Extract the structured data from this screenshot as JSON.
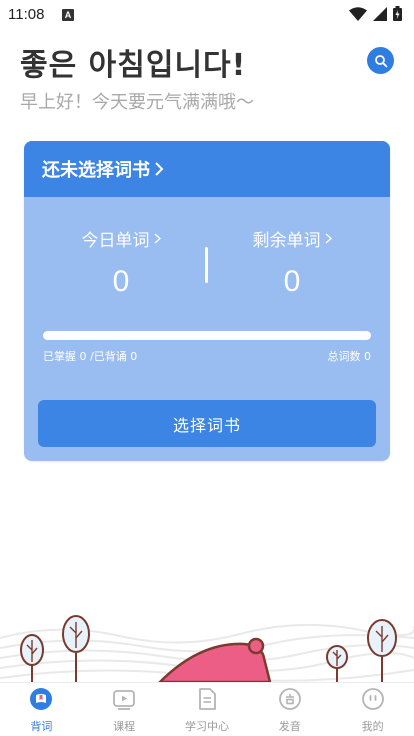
{
  "status": {
    "time": "11:08",
    "app_indicator": "A"
  },
  "header": {
    "greeting": "좋은 아침입니다!",
    "subgreeting": "早上好！今天要元气满满哦～"
  },
  "card": {
    "title": "还未选择词书",
    "today_words": {
      "label": "今日单词",
      "value": "0"
    },
    "remaining_words": {
      "label": "剩余单词",
      "value": "0"
    },
    "progress": {
      "fraction": 0,
      "left_text": "已掌握 0 /已背诵 0",
      "right_text": "总词数 0"
    },
    "button_label": "选择词书"
  },
  "tabs": [
    {
      "label": "背词",
      "icon": "book-bookmark-icon",
      "active": true
    },
    {
      "label": "课程",
      "icon": "play-video-icon",
      "active": false
    },
    {
      "label": "学习中心",
      "icon": "document-icon",
      "active": false
    },
    {
      "label": "发音",
      "icon": "pronunciation-icon",
      "active": false
    },
    {
      "label": "我的",
      "icon": "profile-face-icon",
      "active": false
    }
  ],
  "colors": {
    "accent": "#2f7de1",
    "card_header": "#3c85e5",
    "card_body": "#99bdf1",
    "inactive_tab": "#9a9a9a"
  }
}
